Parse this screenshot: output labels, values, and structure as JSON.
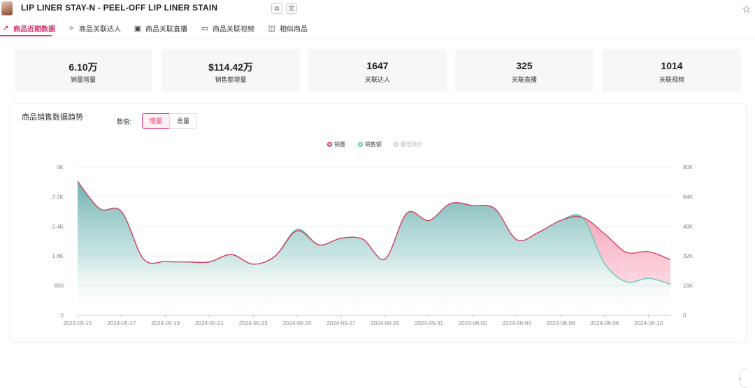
{
  "product": {
    "title": "LIP LINER STAY-N - PEEL-OFF LIP LINER STAIN"
  },
  "header_icons": [
    "copy-icon",
    "translate-icon"
  ],
  "tabs": [
    {
      "label": "商品近期数据",
      "icon": "trend-icon",
      "active": true
    },
    {
      "label": "商品关联达人",
      "icon": "influencer-icon",
      "active": false
    },
    {
      "label": "商品关联直播",
      "icon": "live-icon",
      "active": false
    },
    {
      "label": "商品关联视频",
      "icon": "video-icon",
      "active": false
    },
    {
      "label": "相似商品",
      "icon": "similar-icon",
      "active": false
    }
  ],
  "stats": [
    {
      "value": "6.10万",
      "label": "销量增量"
    },
    {
      "value": "$114.42万",
      "label": "销售额增量"
    },
    {
      "value": "1647",
      "label": "关联达人"
    },
    {
      "value": "325",
      "label": "关联直播"
    },
    {
      "value": "1014",
      "label": "关联视频"
    }
  ],
  "chart_panel": {
    "title": "商品销售数据趋势",
    "value_label": "数值:",
    "toggle": {
      "increment": "增量",
      "total": "总量",
      "selected": "增量"
    }
  },
  "colors": {
    "accent": "#e0316a",
    "sales_line": "#d9365f",
    "revenue_line": "#5fc4b0",
    "price_line": "#c8c8c8"
  },
  "chart_data": {
    "type": "area",
    "title": "",
    "legend": [
      "销量",
      "销售额",
      "最低售价"
    ],
    "legend_position": "top-center",
    "x_ticks": [
      "2024-05-15",
      "2024-05-17",
      "2024-05-19",
      "2024-05-21",
      "2024-05-23",
      "2024-05-25",
      "2024-05-27",
      "2024-05-29",
      "2024-05-31",
      "2024-06-02",
      "2024-06-04",
      "2024-06-06",
      "2024-06-08",
      "2024-06-10"
    ],
    "x": [
      "05-15",
      "05-16",
      "05-17",
      "05-18",
      "05-19",
      "05-20",
      "05-21",
      "05-22",
      "05-23",
      "05-24",
      "05-25",
      "05-26",
      "05-27",
      "05-28",
      "05-29",
      "05-30",
      "05-31",
      "06-01",
      "06-02",
      "06-03",
      "06-04",
      "06-05",
      "06-06",
      "06-07",
      "06-08",
      "06-09",
      "06-10",
      "06-11"
    ],
    "y_left": {
      "ticks": [
        "0",
        "800",
        "1.6K",
        "2.4K",
        "3.2K",
        "4K"
      ],
      "range": [
        0,
        4000
      ]
    },
    "y_right": {
      "ticks": [
        "0",
        "16K",
        "32K",
        "48K",
        "64K",
        "80K"
      ],
      "range": [
        0,
        80000
      ]
    },
    "grid": true,
    "series": [
      {
        "name": "销量",
        "axis": "left",
        "values": [
          3620,
          2880,
          2800,
          1520,
          1450,
          1440,
          1440,
          1640,
          1380,
          1600,
          2280,
          1900,
          2080,
          2050,
          1520,
          2760,
          2560,
          3020,
          2960,
          2880,
          2040,
          2240,
          2560,
          2640,
          2200,
          1700,
          1720,
          1500
        ]
      },
      {
        "name": "销售额",
        "axis": "right",
        "values": [
          72000,
          57600,
          56000,
          30400,
          29000,
          28800,
          28800,
          32800,
          27600,
          32000,
          46400,
          38000,
          41600,
          41000,
          30400,
          55200,
          51200,
          60400,
          59200,
          57600,
          40800,
          44800,
          51200,
          52800,
          28000,
          18000,
          20000,
          16800
        ]
      }
    ]
  }
}
